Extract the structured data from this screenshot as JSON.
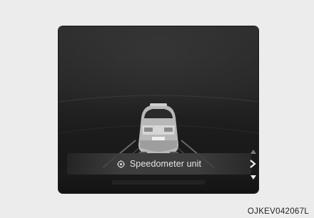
{
  "menu": {
    "item_label": "Speedometer unit",
    "item_icon": "gear-icon",
    "nav_icons": [
      "chevron-up-icon",
      "chevron-right-icon",
      "chevron-down-icon"
    ]
  },
  "figure": {
    "code": "OJKEV042067L"
  },
  "colors": {
    "background": "#ececec",
    "display": "#222222",
    "menu_row": "#3d3d3d",
    "text": "#e6e6e6"
  }
}
